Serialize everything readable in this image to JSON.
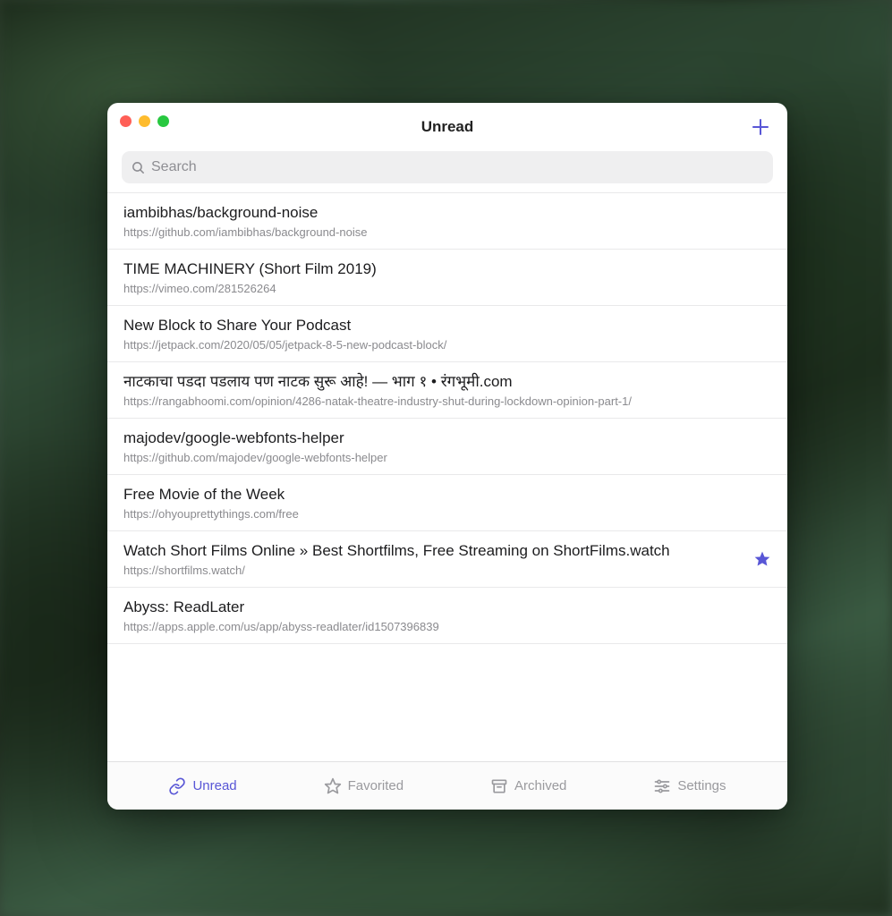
{
  "header": {
    "title": "Unread"
  },
  "search": {
    "placeholder": "Search",
    "value": ""
  },
  "colors": {
    "accent": "#5856d6"
  },
  "items": [
    {
      "title": "iambibhas/background-noise",
      "url": "https://github.com/iambibhas/background-noise",
      "favorited": false
    },
    {
      "title": "TIME MACHINERY (Short Film 2019)",
      "url": "https://vimeo.com/281526264",
      "favorited": false
    },
    {
      "title": "New Block to Share Your Podcast",
      "url": "https://jetpack.com/2020/05/05/jetpack-8-5-new-podcast-block/",
      "favorited": false
    },
    {
      "title": "नाटकाचा पडदा पडलाय पण नाटक सुरू आहे! — भाग १ • रंगभूमी.com",
      "url": "https://rangabhoomi.com/opinion/4286-natak-theatre-industry-shut-during-lockdown-opinion-part-1/",
      "favorited": false
    },
    {
      "title": "majodev/google-webfonts-helper",
      "url": "https://github.com/majodev/google-webfonts-helper",
      "favorited": false
    },
    {
      "title": "Free Movie of the Week",
      "url": "https://ohyouprettythings.com/free",
      "favorited": false
    },
    {
      "title": "Watch Short Films Online » Best Shortfilms, Free Streaming on ShortFilms.watch",
      "url": "https://shortfilms.watch/",
      "favorited": true
    },
    {
      "title": "Abyss: ReadLater",
      "url": "https://apps.apple.com/us/app/abyss-readlater/id1507396839",
      "favorited": false
    }
  ],
  "tabs": [
    {
      "id": "unread",
      "label": "Unread",
      "icon": "link-icon",
      "active": true
    },
    {
      "id": "favorited",
      "label": "Favorited",
      "icon": "star-outline-icon",
      "active": false
    },
    {
      "id": "archived",
      "label": "Archived",
      "icon": "archive-icon",
      "active": false
    },
    {
      "id": "settings",
      "label": "Settings",
      "icon": "sliders-icon",
      "active": false
    }
  ]
}
